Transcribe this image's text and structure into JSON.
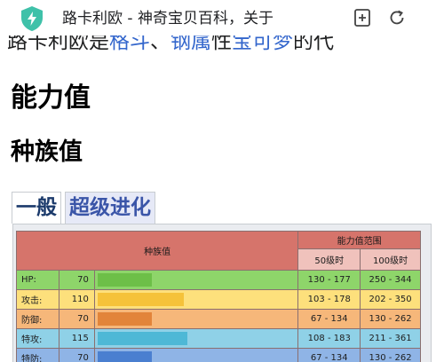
{
  "browser": {
    "tab_title": "路卡利欧 - 神奇宝贝百科，关于",
    "icons": [
      "shield-check-icon",
      "add-bookmark-icon",
      "reload-icon"
    ]
  },
  "intro_line": {
    "text_a": "路卡利欧是",
    "link_a": "格斗",
    "text_b": "、",
    "link_b": "钢属",
    "text_c": "性",
    "link_c": "宝可梦",
    "text_d": "的代"
  },
  "section": {
    "heading": "能力值",
    "subheading": "种族值"
  },
  "tabs": [
    {
      "label": "一般",
      "active": true
    },
    {
      "label": "超级进化",
      "active": false
    }
  ],
  "stats_table": {
    "header_base": "种族值",
    "header_range": "能力值范围",
    "col_level50": "50级时",
    "col_level100": "100级时",
    "max_stat": 255,
    "rows": [
      {
        "name": "HP:",
        "value": "70",
        "range50": "130 - 177",
        "range100": "250 - 344",
        "row_color": "#8ed56a",
        "bar_color": "#6dbf48"
      },
      {
        "name": "攻击:",
        "value": "110",
        "range50": "103 - 178",
        "range100": "202 - 350",
        "row_color": "#fde07c",
        "bar_color": "#f5c23a"
      },
      {
        "name": "防御:",
        "value": "70",
        "range50": "67 - 134",
        "range100": "130 - 262",
        "row_color": "#f6b77a",
        "bar_color": "#e2843a"
      },
      {
        "name": "特攻:",
        "value": "115",
        "range50": "108 - 183",
        "range100": "211 - 361",
        "row_color": "#8fd1e7",
        "bar_color": "#4eb8d6"
      },
      {
        "name": "特防:",
        "value": "70",
        "range50": "67 - 134",
        "range100": "130 - 262",
        "row_color": "#8fb4e6",
        "bar_color": "#4a7fd0"
      }
    ]
  }
}
